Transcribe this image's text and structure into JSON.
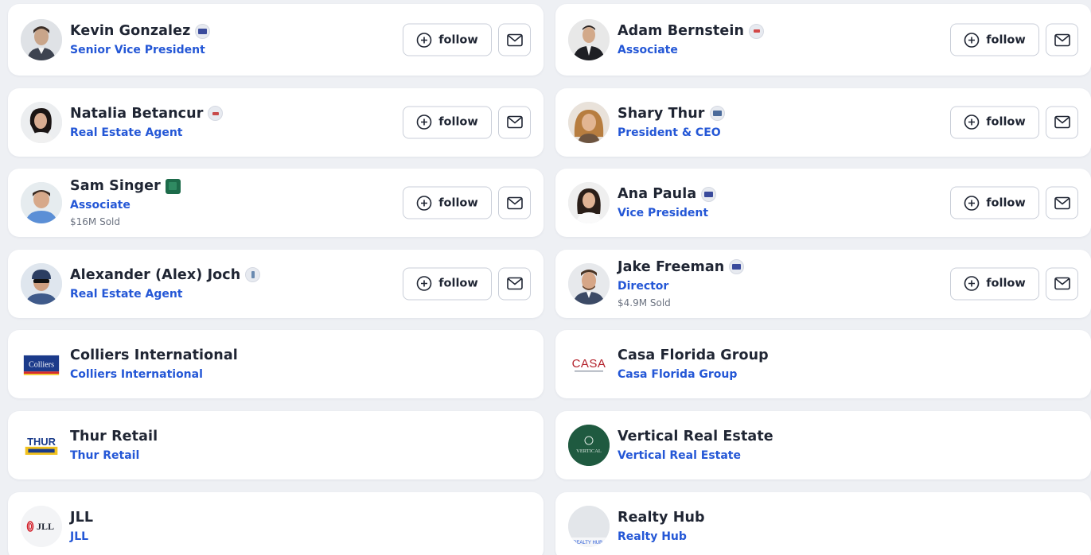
{
  "people": [
    {
      "name": "Kevin Gonzalez",
      "title": "Senior Vice President",
      "sold": "",
      "badge_color": "#3a4b9c",
      "avatar": "man-short"
    },
    {
      "name": "Adam Bernstein",
      "title": "Associate",
      "sold": "",
      "badge_color": "#d24848",
      "avatar": "man-suit"
    },
    {
      "name": "Natalia Betancur",
      "title": "Real Estate Agent",
      "sold": "",
      "badge_color": "#c84a4a",
      "avatar": "woman-dark"
    },
    {
      "name": "Shary Thur",
      "title": "President & CEO",
      "sold": "",
      "badge_color": "#4a6a9a",
      "avatar": "woman-blonde"
    },
    {
      "name": "Sam Singer",
      "title": "Associate",
      "sold": "$16M Sold",
      "badge_color": "#1d6b4a",
      "avatar": "man-blue"
    },
    {
      "name": "Ana Paula",
      "title": "Vice President",
      "sold": "",
      "badge_color": "#3a4b9c",
      "avatar": "woman-brunette"
    },
    {
      "name": "Alexander (Alex) Joch",
      "title": "Real Estate Agent",
      "sold": "",
      "badge_color": "#6a8ab0",
      "avatar": "man-cap"
    },
    {
      "name": "Jake Freeman",
      "title": "Director",
      "sold": "$4.9M Sold",
      "badge_color": "#3a4b9c",
      "avatar": "man-beard"
    }
  ],
  "companies": [
    {
      "name": "Colliers International",
      "subtitle": "Colliers International",
      "logo_text": "Colliers"
    },
    {
      "name": "Casa Florida Group",
      "subtitle": "Casa Florida Group",
      "logo_text": "CASA"
    },
    {
      "name": "Thur Retail",
      "subtitle": "Thur Retail",
      "logo_text": "THUR"
    },
    {
      "name": "Vertical Real Estate",
      "subtitle": "Vertical Real Estate",
      "logo_text": "VERTICAL"
    },
    {
      "name": "JLL",
      "subtitle": "JLL",
      "logo_text": "JLL"
    },
    {
      "name": "Realty Hub",
      "subtitle": "Realty Hub",
      "logo_text": "REALTY HUB"
    }
  ],
  "actions": {
    "follow_label": "follow"
  },
  "colors": {
    "accent": "#2457d6",
    "text": "#1f2533",
    "card": "#ffffff",
    "background": "#eef0f4"
  }
}
